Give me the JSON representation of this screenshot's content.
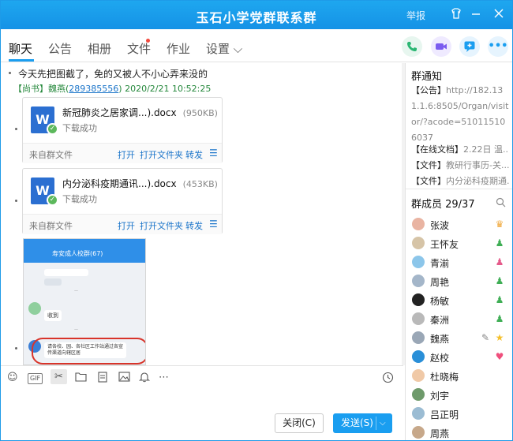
{
  "window": {
    "title": "玉石小学党群联系群",
    "report_label": "举报"
  },
  "tabs": [
    {
      "label": "聊天"
    },
    {
      "label": "公告"
    },
    {
      "label": "相册"
    },
    {
      "label": "文件"
    },
    {
      "label": "作业"
    },
    {
      "label": "设置 ⌵"
    }
  ],
  "chat": {
    "text_message": "今天先把图截了，免的又被人不小心弄来没的",
    "sender_name": "【尚书】魏燕(",
    "sender_qq": "289385556",
    "sender_time": ")  2020/2/21 10:52:25",
    "files": [
      {
        "name": "新冠肺炎之居家调...).docx",
        "size": "(950KB)",
        "status": "下载成功",
        "source": "来自群文件",
        "open": "打开",
        "open_folder": "打开文件夹",
        "forward": "转发"
      },
      {
        "name": "内分泌科疫期通讯...).docx",
        "size": "(453KB)",
        "status": "下载成功",
        "source": "来自群文件",
        "open": "打开",
        "open_folder": "打开文件夹",
        "forward": "转发"
      }
    ],
    "screenshot": {
      "group_title": "寿安成人校群(67)",
      "msg_received": "收到",
      "msg_notice": "请各校、园、各社区工作站通过各宣传渠道向辖区居"
    }
  },
  "buttons": {
    "close": "关闭(C)",
    "send": "发送(S)"
  },
  "side": {
    "notice_title": "群通知",
    "notice_prefix": "【公告】",
    "notice_url": "http://182.131.1.6:8505/Organ/visitor/?acode=510115106037",
    "file_lines": [
      {
        "tag": "【在线文档】",
        "text": "2.22日 温..."
      },
      {
        "tag": "【文件】",
        "text": "教研行事历-关..."
      },
      {
        "tag": "【文件】",
        "text": "内分泌科疫期通..."
      }
    ],
    "members_title": "群成员 29/37",
    "members": [
      {
        "name": "张波"
      },
      {
        "name": "王怀友"
      },
      {
        "name": "青湔"
      },
      {
        "name": "周艳"
      },
      {
        "name": "杨敏"
      },
      {
        "name": "秦洲"
      },
      {
        "name": "魏燕"
      },
      {
        "name": "赵校"
      },
      {
        "name": "杜晓梅"
      },
      {
        "name": "刘宇"
      },
      {
        "name": "吕正明"
      },
      {
        "name": "周燕"
      }
    ]
  },
  "colors": {
    "accent": "#1a9ef0",
    "sender_green": "#23873a",
    "link_blue": "#1a74c9"
  }
}
